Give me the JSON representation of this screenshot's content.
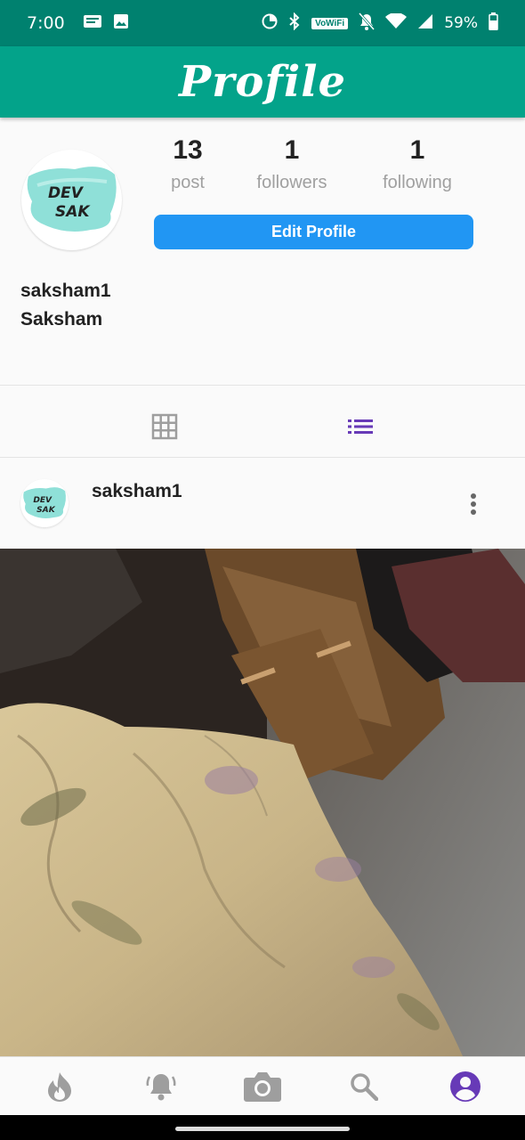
{
  "status": {
    "time": "7:00",
    "wifi_label": "VoWiFi",
    "battery": "59%",
    "left_icons": [
      "message-icon",
      "image-icon"
    ],
    "right_icons": [
      "data-saver-icon",
      "bluetooth-icon",
      "vowifi-icon",
      "bell-off-icon",
      "wifi-icon",
      "signal-icon",
      "battery-icon"
    ]
  },
  "appbar": {
    "title": "Profile"
  },
  "profile": {
    "avatar_text": [
      "DEV",
      "SAK"
    ],
    "stats": [
      {
        "value": "13",
        "label": "post"
      },
      {
        "value": "1",
        "label": "followers"
      },
      {
        "value": "1",
        "label": "following"
      }
    ],
    "edit_button": "Edit Profile",
    "username": "saksham1",
    "full_name": "Saksham"
  },
  "view_toggle": {
    "options": [
      "grid",
      "list"
    ],
    "active": "list",
    "active_color": "#673ab7",
    "inactive_color": "#9e9e9e"
  },
  "post": {
    "username": "saksham1",
    "avatar_text": [
      "DEV",
      "SAK"
    ]
  },
  "bottom_nav": {
    "items": [
      "flame-icon",
      "bell-icon",
      "camera-icon",
      "search-icon",
      "account-icon"
    ],
    "active": "account-icon",
    "active_color": "#673ab7"
  },
  "colors": {
    "statusbar": "#00816f",
    "appbar": "#03a38a",
    "primary_button": "#2196f3",
    "accent": "#673ab7"
  }
}
